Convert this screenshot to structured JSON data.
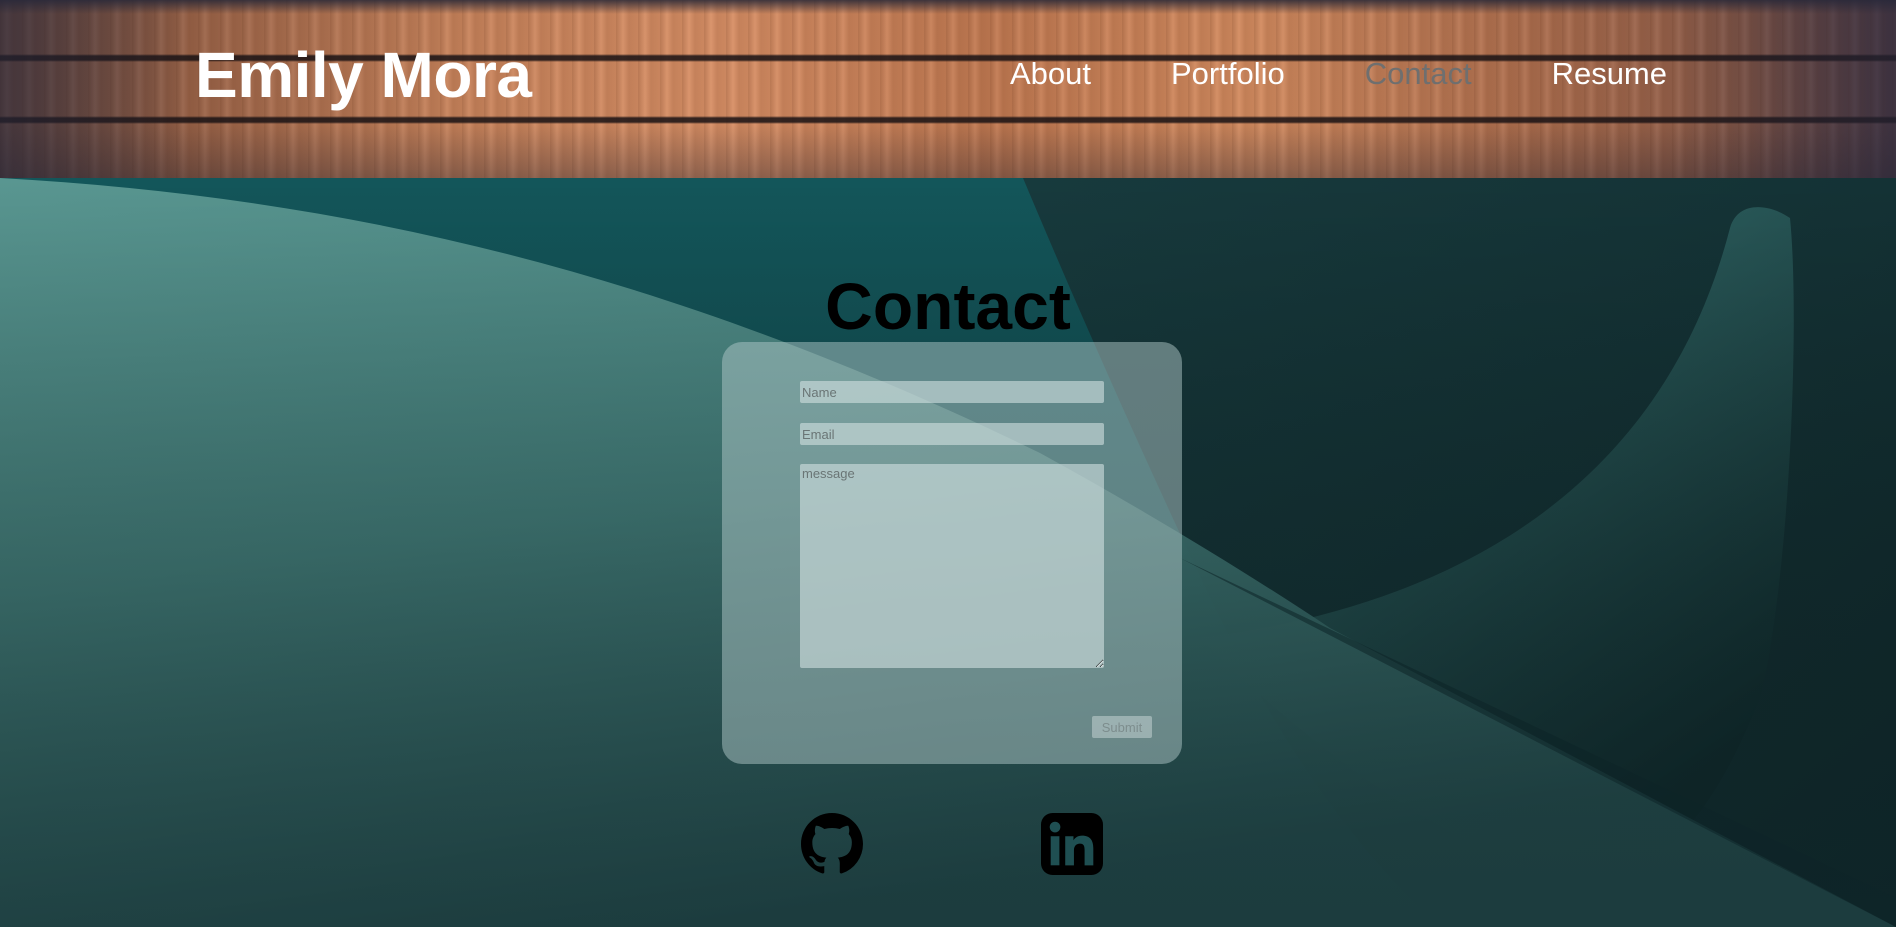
{
  "brand": {
    "name": "Emily Mora"
  },
  "nav": {
    "items": [
      {
        "label": "About",
        "active": false
      },
      {
        "label": "Portfolio",
        "active": false
      },
      {
        "label": "Contact",
        "active": true
      },
      {
        "label": "Resume",
        "active": false
      }
    ]
  },
  "section": {
    "title": "Contact"
  },
  "form": {
    "name_placeholder": "Name",
    "email_placeholder": "Email",
    "message_placeholder": "message",
    "submit_label": "Submit"
  },
  "social": [
    {
      "icon": "github-icon"
    },
    {
      "icon": "linkedin-icon"
    }
  ],
  "colors": {
    "nav_active": "#6f6f6f",
    "background_teal": "#13565a",
    "background_dark": "#142f33"
  }
}
